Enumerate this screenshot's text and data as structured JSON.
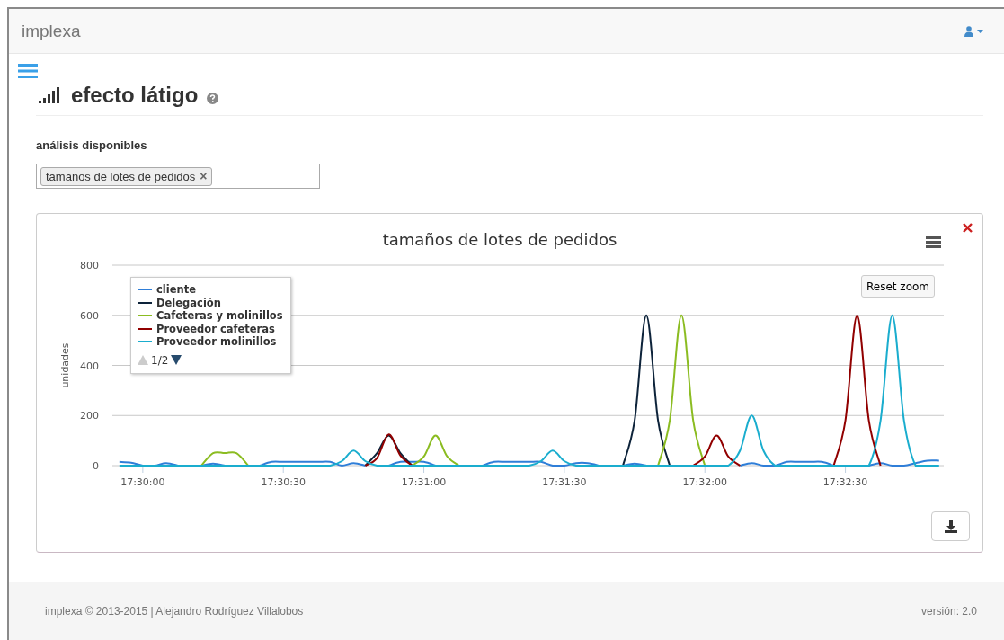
{
  "navbar": {
    "brand": "implexa"
  },
  "page": {
    "title": "efecto látigo"
  },
  "analysis": {
    "label": "análisis disponibles",
    "tags": [
      {
        "label": "tamaños de lotes de pedidos",
        "remove": "×"
      }
    ]
  },
  "panel": {
    "reset_zoom": "Reset zoom",
    "legend_pager": {
      "label": "1/2",
      "up_disabled": true,
      "down_disabled": false
    },
    "chart_data": {
      "type": "line",
      "title": "tamaños de lotes de pedidos",
      "ylabel": "unidades",
      "grid": true,
      "legend": true,
      "xlim": [
        62993.5,
        63171
      ],
      "ylim": [
        0,
        800
      ],
      "yticks": [
        0,
        200,
        400,
        600,
        800
      ],
      "xticks": [
        {
          "value": 63000,
          "label": "17:30:00"
        },
        {
          "value": 63030,
          "label": "17:30:30"
        },
        {
          "value": 63060,
          "label": "17:31:00"
        },
        {
          "value": 63090,
          "label": "17:31:30"
        },
        {
          "value": 63120,
          "label": "17:32:00"
        },
        {
          "value": 63150,
          "label": "17:32:30"
        }
      ],
      "x": [
        62995,
        62997.5,
        63000,
        63002.5,
        63005,
        63007.5,
        63010,
        63012.5,
        63015,
        63017.5,
        63020,
        63022.5,
        63025,
        63027.5,
        63030,
        63032.5,
        63035,
        63037.5,
        63040,
        63042.5,
        63045,
        63047.5,
        63050,
        63052.5,
        63055,
        63057.5,
        63060,
        63062.5,
        63065,
        63067.5,
        63070,
        63072.5,
        63075,
        63077.5,
        63080,
        63082.5,
        63085,
        63087.5,
        63090,
        63092.5,
        63095,
        63097.5,
        63100,
        63102.5,
        63105,
        63107.5,
        63110,
        63112.5,
        63115,
        63117.5,
        63120,
        63122.5,
        63125,
        63127.5,
        63130,
        63132.5,
        63135,
        63137.5,
        63140,
        63142.5,
        63145,
        63147.5,
        63150,
        63152.5,
        63155,
        63157.5,
        63160,
        63162.5,
        63165,
        63167.5,
        63170
      ],
      "series": [
        {
          "name": "cliente",
          "color": "#2f7ed8",
          "values": [
            15,
            12,
            0,
            0,
            10,
            0,
            null,
            0,
            8,
            0,
            null,
            null,
            0,
            15,
            15,
            15,
            15,
            15,
            15,
            0,
            10,
            0,
            null,
            0,
            15,
            15,
            15,
            0,
            null,
            null,
            null,
            0,
            15,
            15,
            15,
            15,
            15,
            0,
            0,
            10,
            10,
            0,
            null,
            0,
            8,
            0,
            null,
            null,
            null,
            null,
            null,
            null,
            null,
            0,
            10,
            0,
            0,
            15,
            15,
            15,
            15,
            0,
            null,
            null,
            0,
            10,
            0,
            0,
            10,
            20,
            20
          ]
        },
        {
          "name": "Delegación",
          "color": "#0d233a",
          "values": [
            null,
            null,
            null,
            null,
            null,
            null,
            null,
            null,
            null,
            null,
            null,
            null,
            null,
            null,
            null,
            null,
            null,
            null,
            null,
            null,
            null,
            0,
            50,
            120,
            50,
            0,
            null,
            null,
            null,
            null,
            null,
            null,
            null,
            null,
            null,
            null,
            null,
            null,
            null,
            null,
            null,
            null,
            null,
            0,
            180,
            600,
            180,
            0,
            null,
            null,
            null,
            null,
            null,
            null,
            null,
            null,
            null,
            null,
            null,
            null,
            null,
            null,
            null,
            null,
            null,
            null,
            null,
            null,
            null,
            null,
            null
          ]
        },
        {
          "name": "Cafeteras y molinillos",
          "color": "#8bbc21",
          "values": [
            null,
            null,
            null,
            null,
            null,
            null,
            null,
            0,
            50,
            50,
            50,
            0,
            null,
            null,
            null,
            null,
            null,
            null,
            null,
            null,
            null,
            null,
            null,
            null,
            null,
            0,
            36,
            120,
            36,
            0,
            null,
            null,
            null,
            null,
            null,
            null,
            null,
            null,
            null,
            null,
            null,
            null,
            null,
            null,
            null,
            null,
            0,
            180,
            600,
            180,
            0,
            null,
            null,
            null,
            null,
            null,
            null,
            null,
            null,
            null,
            null,
            null,
            null,
            null,
            null,
            null,
            null,
            null,
            null,
            null,
            null
          ]
        },
        {
          "name": "Proveedor cafeteras",
          "color": "#910000",
          "values": [
            null,
            null,
            null,
            null,
            null,
            null,
            null,
            null,
            null,
            null,
            null,
            null,
            null,
            null,
            null,
            null,
            null,
            null,
            null,
            null,
            null,
            0,
            30,
            125,
            40,
            0,
            null,
            null,
            null,
            null,
            null,
            null,
            null,
            null,
            null,
            null,
            null,
            null,
            null,
            null,
            null,
            null,
            null,
            null,
            null,
            null,
            null,
            null,
            null,
            0,
            36,
            120,
            36,
            0,
            null,
            null,
            null,
            null,
            null,
            null,
            null,
            0,
            180,
            600,
            180,
            0,
            null,
            null,
            null,
            null,
            null
          ]
        },
        {
          "name": "Proveedor molinillos",
          "color": "#1aadce",
          "values": [
            0,
            0,
            0,
            0,
            0,
            0,
            0,
            0,
            0,
            0,
            0,
            0,
            0,
            0,
            0,
            0,
            0,
            0,
            0,
            18,
            60,
            18,
            0,
            0,
            0,
            0,
            0,
            0,
            0,
            0,
            0,
            0,
            0,
            0,
            0,
            0,
            18,
            60,
            18,
            0,
            0,
            0,
            0,
            0,
            0,
            0,
            0,
            0,
            0,
            0,
            0,
            0,
            0,
            60,
            200,
            60,
            0,
            0,
            0,
            0,
            0,
            0,
            0,
            0,
            0,
            180,
            600,
            180,
            0,
            0,
            0
          ]
        }
      ]
    }
  },
  "footer": {
    "credits": "implexa © 2013-2015 | Alejandro Rodríguez Villalobos",
    "version": "versión: 2.0"
  }
}
